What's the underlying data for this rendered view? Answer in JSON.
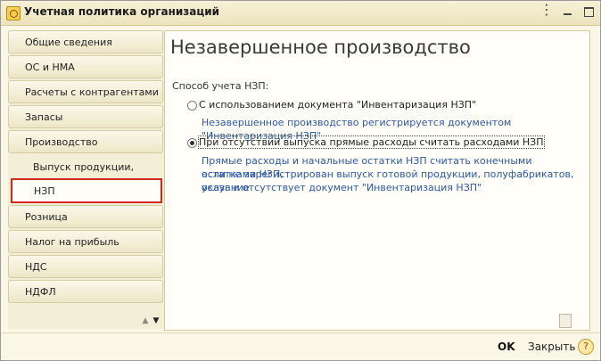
{
  "window": {
    "title": "Учетная политика организаций",
    "more_glyph": "⋮",
    "minimize_label": "",
    "maximize_label": ""
  },
  "sidebar": {
    "items": [
      {
        "label": "Общие сведения"
      },
      {
        "label": "ОС и НМА"
      },
      {
        "label": "Расчеты с контрагентами"
      },
      {
        "label": "Запасы"
      },
      {
        "label": "Производство"
      },
      {
        "label": "Выпуск продукции, услуг"
      },
      {
        "label": "НЗП"
      },
      {
        "label": "Розница"
      },
      {
        "label": "Налог на прибыль"
      },
      {
        "label": "НДС"
      },
      {
        "label": "НДФЛ"
      }
    ],
    "scroll_up": "▲",
    "scroll_down": "▼"
  },
  "main": {
    "title": "Незавершенное производство",
    "group_label": "Способ учета НЗП:",
    "options": [
      {
        "label": "С использованием документа \"Инвентаризация НЗП\"",
        "hint": "Незавершенное производство регистрируется документом \"Инвентаризация НЗП\"",
        "selected": false
      },
      {
        "label": "При отсутствии выпуска прямые расходы считать расходами НЗП",
        "hint_lines": [
          "Прямые расходы и начальные остатки НЗП считать конечными остатками НЗП,",
          "если не зарегистрирован выпуск готовой продукции, полуфабрикатов, оказание",
          "услуг и отсутствует документ \"Инвентаризация НЗП\""
        ],
        "selected": true
      }
    ]
  },
  "footer": {
    "ok_label": "OK",
    "close_label": "Закрыть",
    "help_label": "?"
  },
  "colors": {
    "accent_red": "#d3281c",
    "hint_blue": "#2b58a6",
    "panel_bg": "#fbf7e6"
  }
}
